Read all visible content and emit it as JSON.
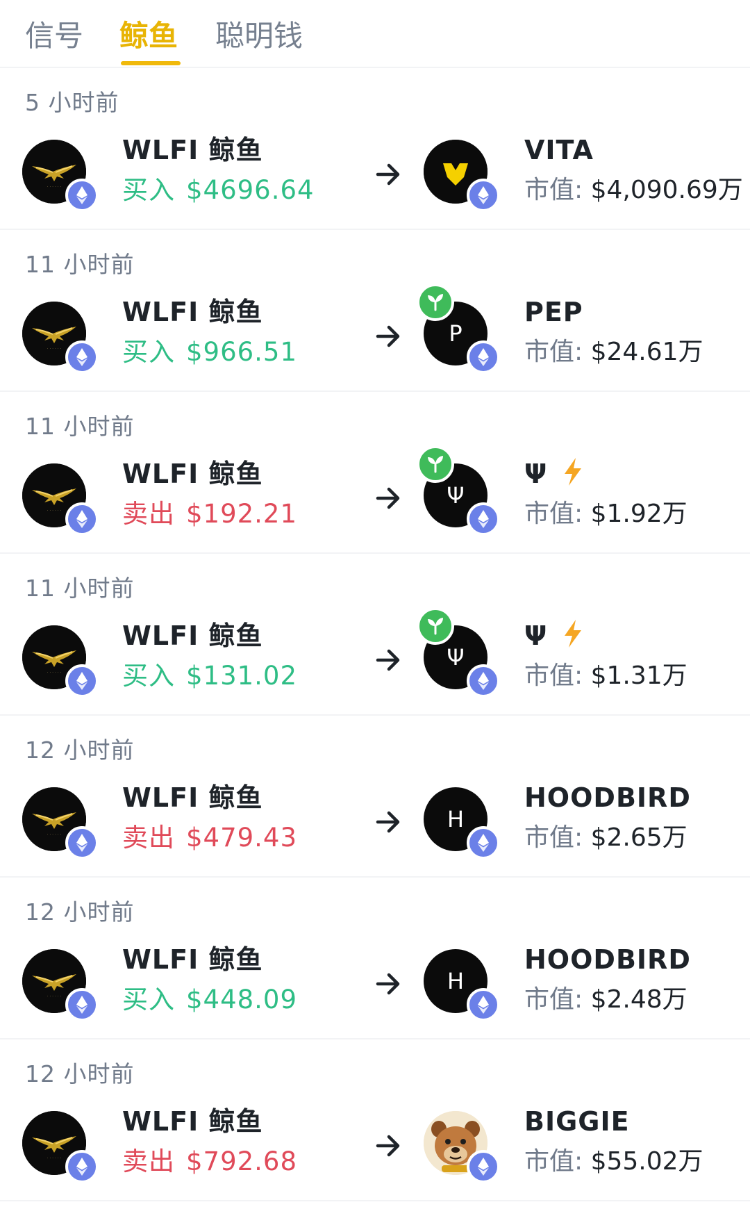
{
  "tabs": [
    {
      "label": "信号",
      "active": false
    },
    {
      "label": "鲸鱼",
      "active": true
    },
    {
      "label": "聪明钱",
      "active": false
    }
  ],
  "colors": {
    "accent": "#f0b90b",
    "buy": "#2ebd85",
    "sell": "#e04a59",
    "muted": "#707a8a",
    "chain": "#6b80e8",
    "new_badge": "#3fbb5a"
  },
  "mcap_label": "市值:",
  "items": [
    {
      "time": "5 小时前",
      "whale": "WLFI 鲸鱼",
      "action": "买入",
      "side": "buy",
      "amount": "$4696.64",
      "token": "VITA",
      "token_avatar": "vita-shield-icon",
      "new": false,
      "bolt": false,
      "mcap": "$4,090.69万"
    },
    {
      "time": "11 小时前",
      "whale": "WLFI 鲸鱼",
      "action": "买入",
      "side": "buy",
      "amount": "$966.51",
      "token": "PEP",
      "token_avatar": "letter",
      "avatar_letter": "P",
      "new": true,
      "bolt": false,
      "mcap": "$24.61万"
    },
    {
      "time": "11 小时前",
      "whale": "WLFI 鲸鱼",
      "action": "卖出",
      "side": "sell",
      "amount": "$192.21",
      "token": "Ψ",
      "token_avatar": "letter",
      "avatar_letter": "Ψ",
      "new": true,
      "bolt": true,
      "mcap": "$1.92万"
    },
    {
      "time": "11 小时前",
      "whale": "WLFI 鲸鱼",
      "action": "买入",
      "side": "buy",
      "amount": "$131.02",
      "token": "Ψ",
      "token_avatar": "letter",
      "avatar_letter": "Ψ",
      "new": true,
      "bolt": true,
      "mcap": "$1.31万"
    },
    {
      "time": "12 小时前",
      "whale": "WLFI 鲸鱼",
      "action": "卖出",
      "side": "sell",
      "amount": "$479.43",
      "token": "HOODBIRD",
      "token_avatar": "letter",
      "avatar_letter": "H",
      "new": false,
      "bolt": false,
      "mcap": "$2.65万"
    },
    {
      "time": "12 小时前",
      "whale": "WLFI 鲸鱼",
      "action": "买入",
      "side": "buy",
      "amount": "$448.09",
      "token": "HOODBIRD",
      "token_avatar": "letter",
      "avatar_letter": "H",
      "new": false,
      "bolt": false,
      "mcap": "$2.48万"
    },
    {
      "time": "12 小时前",
      "whale": "WLFI 鲸鱼",
      "action": "卖出",
      "side": "sell",
      "amount": "$792.68",
      "token": "BIGGIE",
      "token_avatar": "dog-face-icon",
      "new": false,
      "bolt": false,
      "mcap": "$55.02万"
    }
  ]
}
